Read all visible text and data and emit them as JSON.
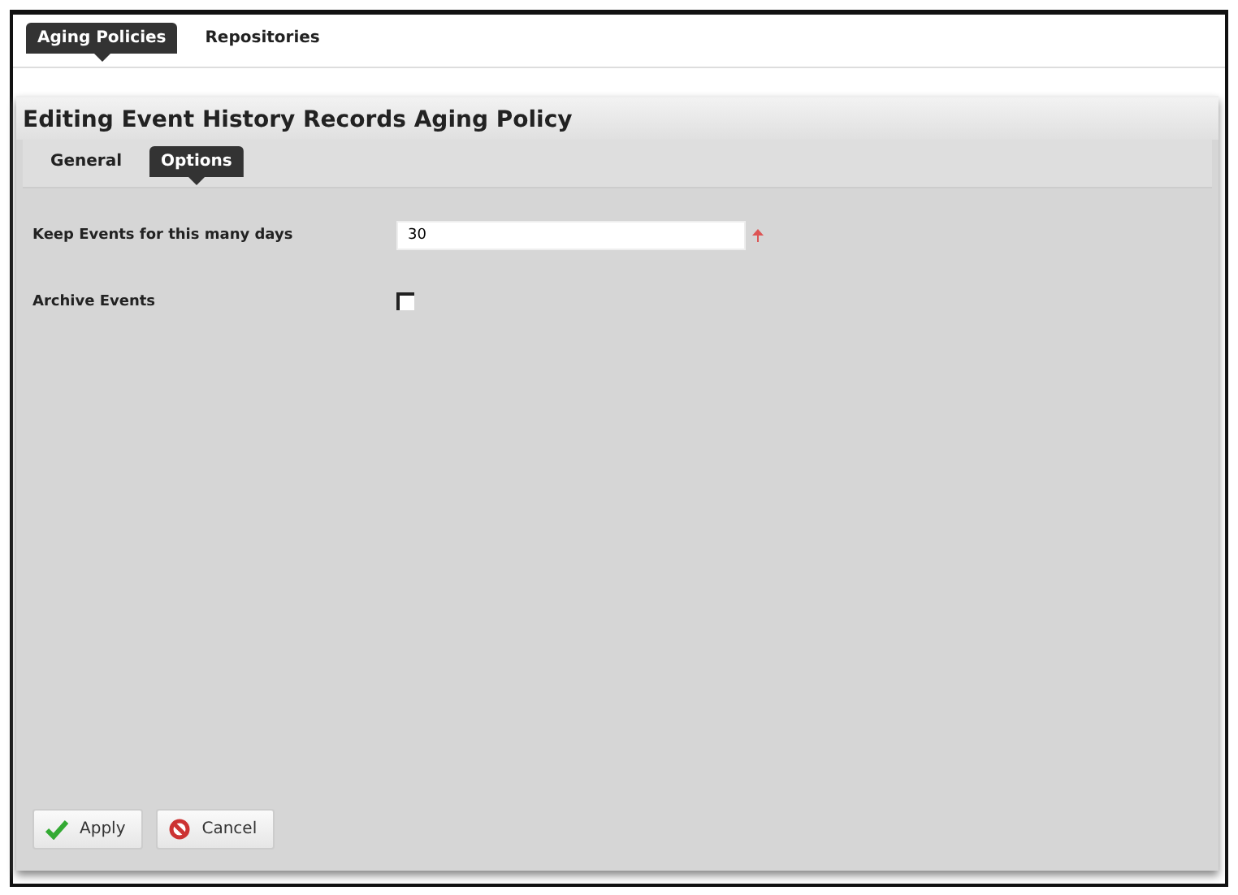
{
  "top_tabs": [
    {
      "label": "Aging Policies",
      "selected": true
    },
    {
      "label": "Repositories",
      "selected": false
    }
  ],
  "panel": {
    "title": "Editing Event History Records Aging Policy",
    "tabs": [
      {
        "label": "General",
        "selected": false
      },
      {
        "label": "Options",
        "selected": true
      }
    ],
    "fields": [
      {
        "kind": "text",
        "label": "Keep Events for this many days",
        "value": "30",
        "required": true
      },
      {
        "kind": "checkbox",
        "label": "Archive Events",
        "checked": false
      }
    ],
    "buttons": [
      {
        "kind": "apply",
        "label": "Apply"
      },
      {
        "kind": "cancel",
        "label": "Cancel"
      }
    ]
  }
}
